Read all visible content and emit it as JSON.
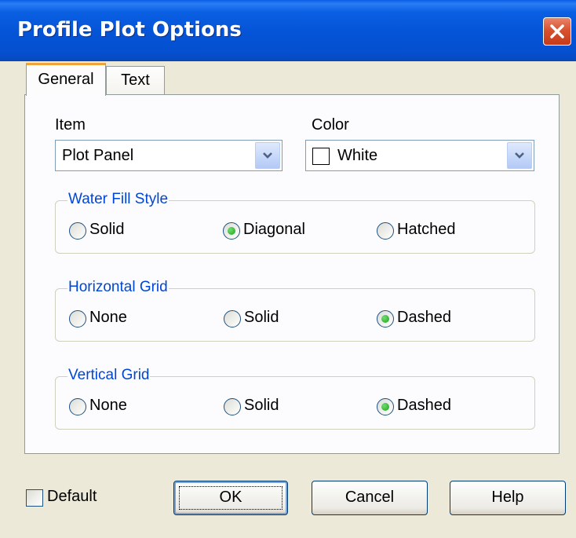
{
  "window": {
    "title": "Profile Plot Options"
  },
  "tabs": [
    {
      "label": "General"
    },
    {
      "label": "Text"
    }
  ],
  "item": {
    "label": "Item",
    "value": "Plot Panel"
  },
  "color": {
    "label": "Color",
    "value": "White",
    "swatch": "#ffffff"
  },
  "water_fill": {
    "title": "Water Fill Style",
    "options": [
      {
        "label": "Solid"
      },
      {
        "label": "Diagonal"
      },
      {
        "label": "Hatched"
      }
    ],
    "selected": "Diagonal"
  },
  "horizontal_grid": {
    "title": "Horizontal Grid",
    "options": [
      {
        "label": "None"
      },
      {
        "label": "Solid"
      },
      {
        "label": "Dashed"
      }
    ],
    "selected": "Dashed"
  },
  "vertical_grid": {
    "title": "Vertical Grid",
    "options": [
      {
        "label": "None"
      },
      {
        "label": "Solid"
      },
      {
        "label": "Dashed"
      }
    ],
    "selected": "Dashed"
  },
  "default_checkbox": {
    "label": "Default",
    "checked": false
  },
  "buttons": {
    "ok": "OK",
    "cancel": "Cancel",
    "help": "Help"
  },
  "colors": {
    "titlebar": "#0553d6",
    "group_title": "#0046d5",
    "tab_highlight": "#f0a33b",
    "dialog_bg": "#ece9d8"
  }
}
